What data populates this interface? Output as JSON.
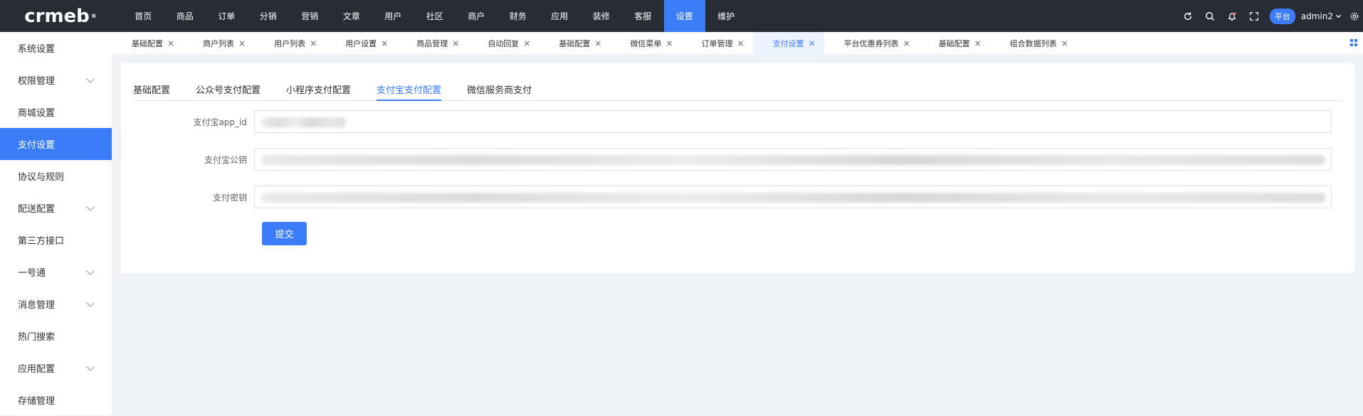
{
  "logo": {
    "text": "crmeb",
    "mark": "®"
  },
  "topnav": {
    "items": [
      "首页",
      "商品",
      "订单",
      "分销",
      "营销",
      "文章",
      "用户",
      "社区",
      "商户",
      "财务",
      "应用",
      "装修",
      "客服",
      "设置",
      "维护"
    ],
    "active": "设置"
  },
  "topright": {
    "icons": [
      "refresh-icon",
      "search-icon",
      "bell-icon",
      "fullscreen-icon"
    ],
    "platform_label": "平台",
    "user": "admin2"
  },
  "sidebar": {
    "items": [
      {
        "label": "系统设置",
        "has_children": false
      },
      {
        "label": "权限管理",
        "has_children": true
      },
      {
        "label": "商城设置",
        "has_children": false
      },
      {
        "label": "支付设置",
        "has_children": false,
        "active": true
      },
      {
        "label": "协议与规则",
        "has_children": false
      },
      {
        "label": "配送配置",
        "has_children": true
      },
      {
        "label": "第三方接口",
        "has_children": false
      },
      {
        "label": "一号通",
        "has_children": true
      },
      {
        "label": "消息管理",
        "has_children": true
      },
      {
        "label": "热门搜索",
        "has_children": false
      },
      {
        "label": "应用配置",
        "has_children": true
      },
      {
        "label": "存储管理",
        "has_children": false
      }
    ]
  },
  "tabs": {
    "items": [
      "基础配置",
      "商户列表",
      "用户列表",
      "用户设置",
      "商品管理",
      "自动回复",
      "基础配置",
      "微信菜单",
      "订单管理",
      "支付设置",
      "平台优惠券列表",
      "基础配置",
      "组合数据列表"
    ],
    "active_index": 9
  },
  "subtabs": {
    "items": [
      "基础配置",
      "公众号支付配置",
      "小程序支付配置",
      "支付宝支付配置",
      "微信服务商支付"
    ],
    "active_index": 3
  },
  "form": {
    "fields": [
      {
        "label": "支付宝app_id"
      },
      {
        "label": "支付宝公钥"
      },
      {
        "label": "支付密钥"
      }
    ],
    "submit_label": "提交"
  }
}
